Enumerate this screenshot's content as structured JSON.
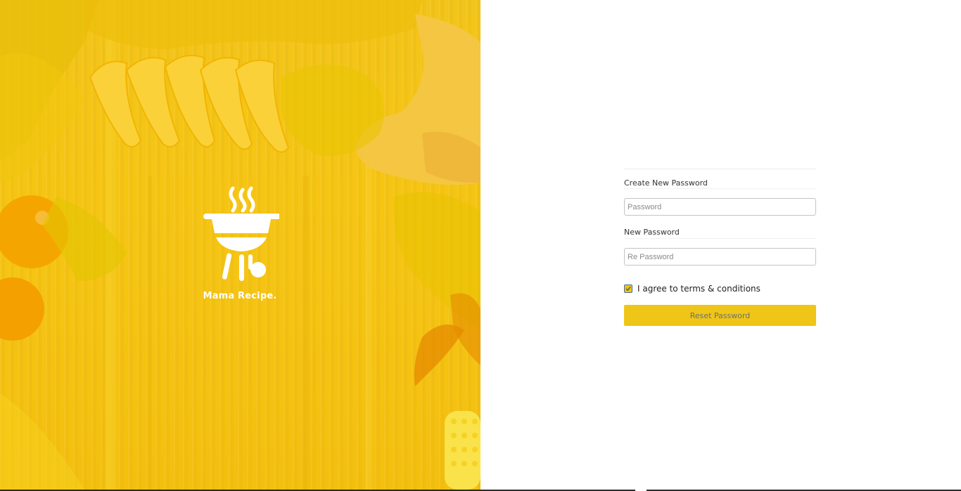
{
  "brand": {
    "name": "Mama Recipe.",
    "logo_icon": "grill-icon"
  },
  "form": {
    "create_label": "Create New Password",
    "password_placeholder": "Password",
    "new_label": "New Password",
    "repassword_placeholder": "Re Password",
    "agree_text": "I agree to terms & conditions",
    "agree_checked": true,
    "submit_label": "Reset Password"
  },
  "colors": {
    "accent": "#efc617",
    "hero_yellow": "#f6c514"
  }
}
